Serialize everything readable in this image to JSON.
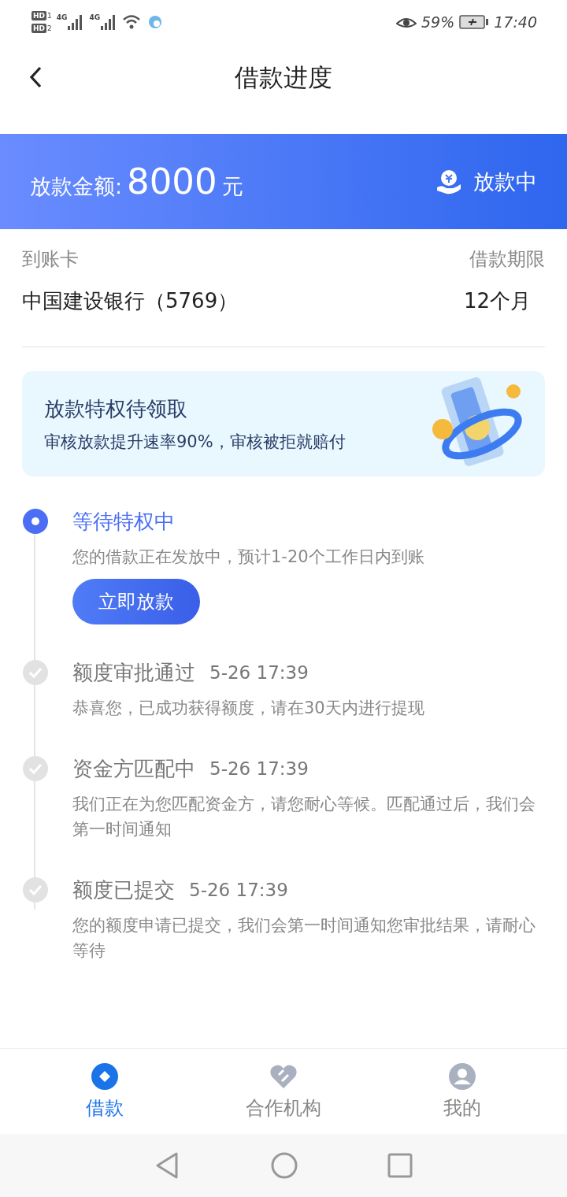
{
  "status_bar": {
    "sims": [
      {
        "badge": "HD",
        "slot": "1"
      },
      {
        "badge": "HD",
        "slot": "2"
      }
    ],
    "networks": [
      "4G",
      "4G"
    ],
    "battery": "59%",
    "time": "17:40"
  },
  "header": {
    "title": "借款进度"
  },
  "banner": {
    "label": "放款金额:",
    "amount": "8000",
    "unit": "元",
    "status": "放款中"
  },
  "info": {
    "card_label": "到账卡",
    "card_value": "中国建设银行（5769）",
    "term_label": "借款期限",
    "term_value": "12个月"
  },
  "promo": {
    "title": "放款特权待领取",
    "subtitle": "审核放款提升速率90%，审核被拒就赔付"
  },
  "steps": [
    {
      "kind": "current",
      "title": "等待特权中",
      "desc": "您的借款正在发放中，预计1-20个工作日内到账",
      "button": "立即放款"
    },
    {
      "kind": "done",
      "title": "额度审批通过",
      "time": "5-26 17:39",
      "desc": "恭喜您，已成功获得额度，请在30天内进行提现"
    },
    {
      "kind": "done",
      "title": "资金方匹配中",
      "time": "5-26 17:39",
      "desc": "我们正在为您匹配资金方，请您耐心等候。匹配通过后，我们会第一时间通知"
    },
    {
      "kind": "done",
      "title": "额度已提交",
      "time": "5-26 17:39",
      "desc": "您的额度申请已提交，我们会第一时间通知您审批结果，请耐心等待"
    }
  ],
  "tabs": [
    {
      "label": "借款",
      "selected": true
    },
    {
      "label": "合作机构",
      "selected": false
    },
    {
      "label": "我的",
      "selected": false
    }
  ]
}
